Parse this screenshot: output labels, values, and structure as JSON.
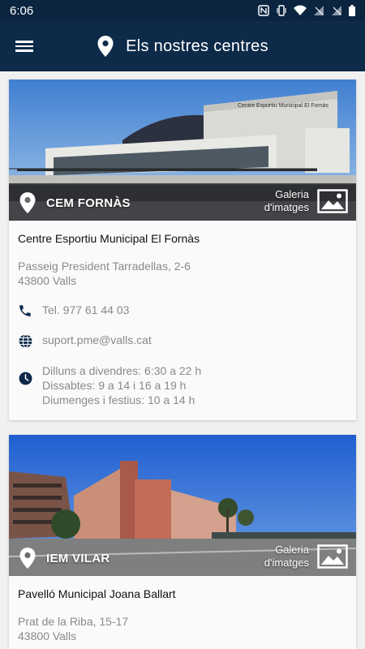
{
  "status": {
    "time": "6:06"
  },
  "header": {
    "title": "Els nostres centres"
  },
  "centers": [
    {
      "badge": "CEM FORNÀS",
      "gallery_line1": "Galeria",
      "gallery_line2": "d'imatges",
      "building_sign": "Centre Esportiu Municipal El Fornàs",
      "name": "Centre Esportiu Municipal El Fornàs",
      "address1": "Passeig President Tarradellas, 2-6",
      "address2": "43800 Valls",
      "phone": "Tel. 977 61 44 03",
      "email": "suport.pme@valls.cat",
      "hours1": "Dilluns a divendres: 6:30 a 22 h",
      "hours2": "Dissabtes: 9 a 14 i 16 a 19 h",
      "hours3": "Diumenges i festius: 10 a 14 h"
    },
    {
      "badge": "IEM VILAR",
      "gallery_line1": "Galeria",
      "gallery_line2": "d'imatges",
      "name": "Pavelló Municipal Joana Ballart",
      "address1": "Prat de la Riba, 15-17",
      "address2": "43800 Valls"
    }
  ],
  "colors": {
    "primary": "#0d2a49",
    "statusbar": "#0b2540",
    "icon": "#0d2a49"
  }
}
